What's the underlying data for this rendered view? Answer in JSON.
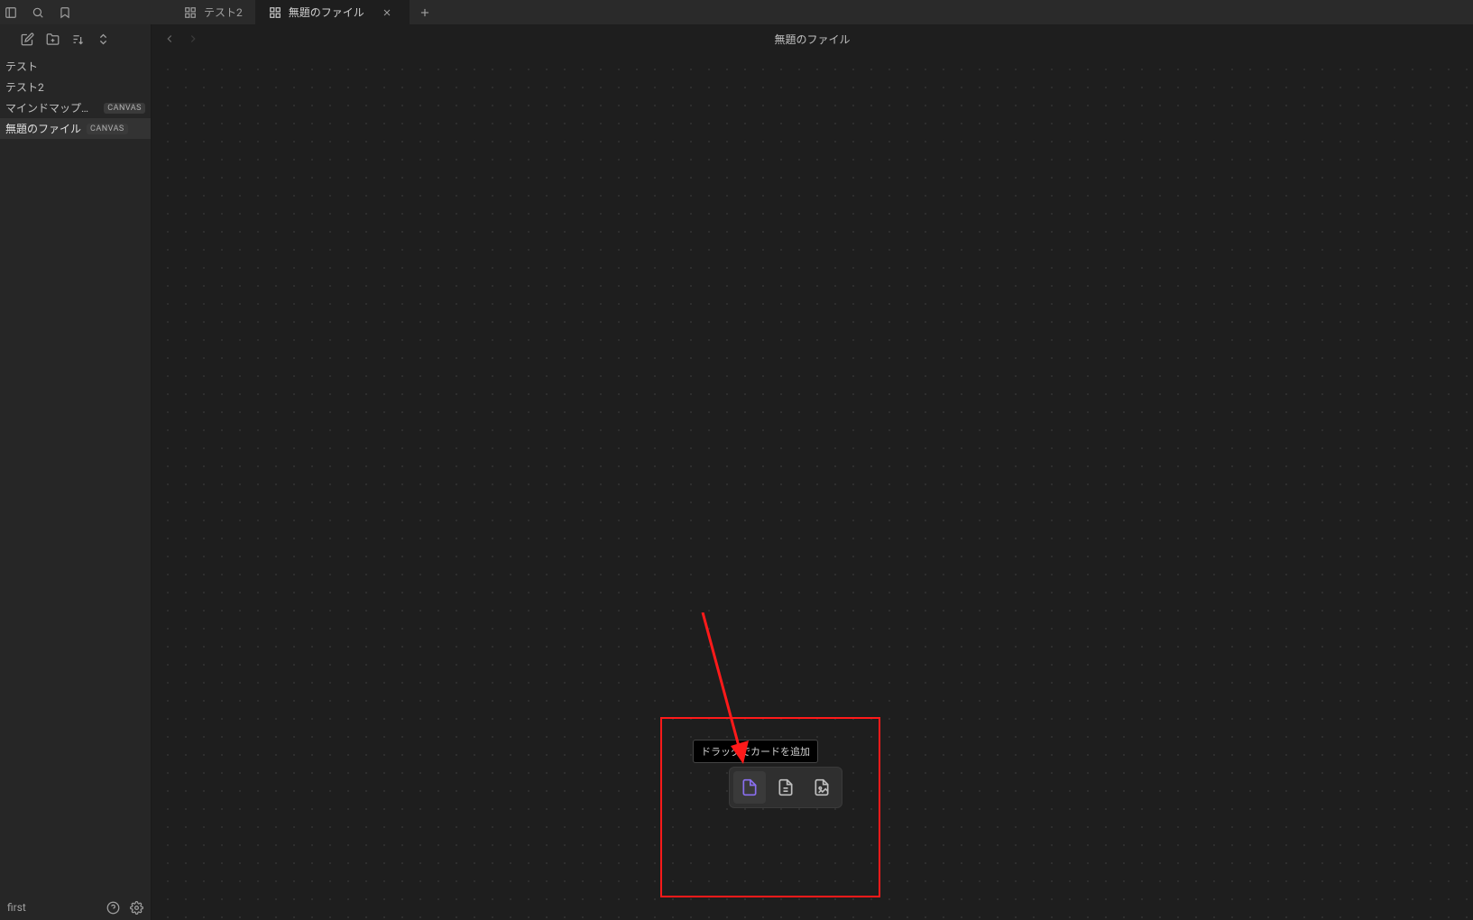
{
  "top": {
    "tabs": [
      {
        "label": "テスト2",
        "active": false,
        "type": "canvas"
      },
      {
        "label": "無題のファイル",
        "active": true,
        "type": "canvas"
      }
    ]
  },
  "sidebar": {
    "files": [
      {
        "name": "テスト",
        "badge": null,
        "active": false
      },
      {
        "name": "テスト2",
        "badge": null,
        "active": false
      },
      {
        "name": "マインドマップの...",
        "badge": "CANVAS",
        "active": false
      },
      {
        "name": "無題のファイル",
        "badge": "CANVAS",
        "active": true
      }
    ],
    "vault": "first"
  },
  "main": {
    "title": "無題のファイル"
  },
  "canvas": {
    "tooltip": "ドラッグでカードを追加",
    "tools": [
      {
        "id": "add-card",
        "active": true
      },
      {
        "id": "add-note",
        "active": false
      },
      {
        "id": "add-media",
        "active": false
      }
    ]
  }
}
